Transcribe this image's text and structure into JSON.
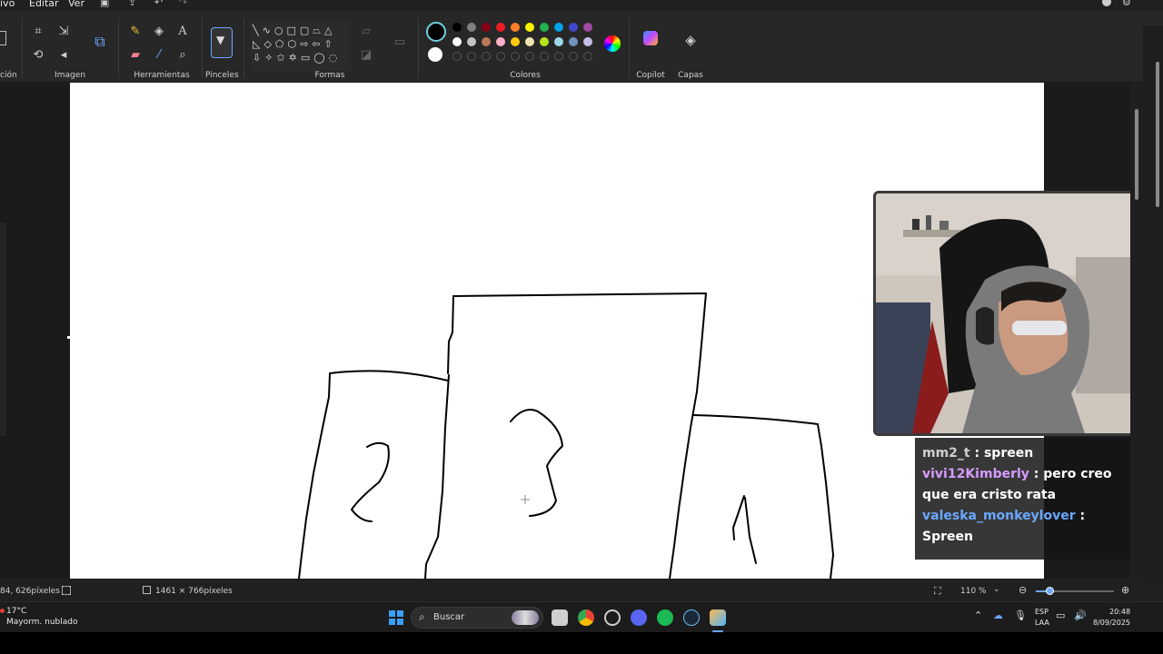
{
  "menu": {
    "file": "ivo",
    "edit": "Editar",
    "view": "Ver"
  },
  "ribbon": {
    "groups": {
      "selection": "ción",
      "image": "Imagen",
      "tools": "Herramientas",
      "brushes": "Pinceles",
      "shapes": "Formas",
      "colors": "Colores",
      "copilot": "Copilot",
      "layers": "Capas"
    },
    "palette_row1": [
      "#000000",
      "#7f7f7f",
      "#880015",
      "#ed1c24",
      "#ff7f27",
      "#fff200",
      "#22b14c",
      "#00a2e8",
      "#3f48cc",
      "#a349a4"
    ],
    "palette_row2": [
      "#ffffff",
      "#c3c3c3",
      "#b97a57",
      "#ffaec9",
      "#ffc90e",
      "#efe4b0",
      "#b5e61d",
      "#99d9ea",
      "#7092be",
      "#c8bfe7"
    ]
  },
  "drawing": {
    "labels": [
      "2",
      "3",
      "1"
    ]
  },
  "chat": {
    "messages": [
      {
        "user": "mm2_t",
        "text": "spreen"
      },
      {
        "user": "vivi12Kimberly",
        "text": "pero creo que era cristo rata"
      },
      {
        "user": "valeska_monkeylover",
        "text": "Spreen"
      }
    ]
  },
  "status": {
    "cursor_pos": "84, 626píxeles",
    "canvas_size": "1461 × 766píxeles",
    "zoom": "110 %"
  },
  "taskbar": {
    "weather_temp": "17°C",
    "weather_desc": "Mayorm. nublado",
    "search_placeholder": "Buscar",
    "lang_top": "ESP",
    "lang_bottom": "LAA",
    "time": "20:48",
    "date": "8/09/2025"
  }
}
